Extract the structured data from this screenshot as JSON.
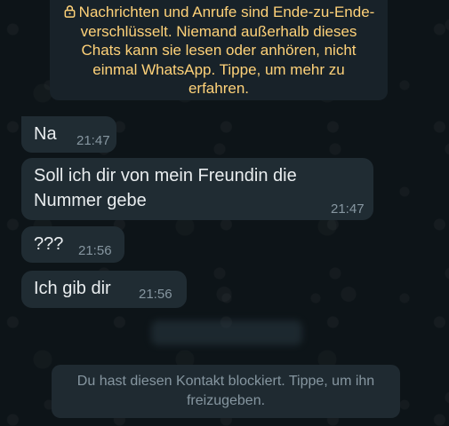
{
  "encryption_notice": {
    "text": "Nachrichten und Anrufe sind Ende-zu-Ende-verschlüsselt. Niemand außerhalb dieses Chats kann sie lesen oder anhören, nicht einmal WhatsApp. Tippe, um mehr zu erfahren."
  },
  "messages": [
    {
      "text": "Na",
      "time": "21:47"
    },
    {
      "text": "Soll ich dir von mein Freundin die Nummer gebe",
      "time": "21:47"
    },
    {
      "text": "???",
      "time": "21:56"
    },
    {
      "text": "Ich gib dir",
      "time": "21:56"
    }
  ],
  "blocked_notice": {
    "text": "Du hast diesen Kontakt blockiert. Tippe, um ihn freizugeben."
  },
  "colors": {
    "background": "#0b141a",
    "bubble": "#202c33",
    "notice_text": "#ffd279",
    "timestamp": "#8696a0"
  }
}
